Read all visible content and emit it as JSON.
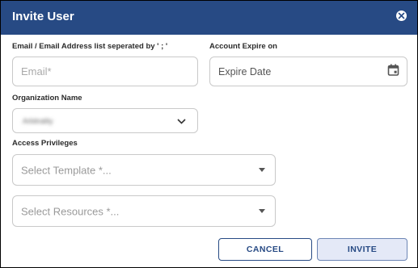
{
  "dialog": {
    "title": "Invite User"
  },
  "email": {
    "label": "Email / Email Address list seperated by ' ; '",
    "placeholder": "Email*"
  },
  "expire": {
    "label": "Account Expire on",
    "placeholder": "Expire Date"
  },
  "organization": {
    "label": "Organization Name",
    "value": "Arbitrality"
  },
  "access": {
    "label": "Access Privileges",
    "template_placeholder": "Select Template *...",
    "resources_placeholder": "Select Resources *..."
  },
  "actions": {
    "cancel": "CANCEL",
    "invite": "INVITE"
  },
  "colors": {
    "header_bg": "#274a84",
    "accent": "#274a84",
    "invite_bg": "#e4e9f7"
  },
  "icons": {
    "close": "close-circle-icon",
    "calendar": "calendar-icon",
    "chevron": "chevron-down-icon",
    "caret": "caret-down-icon"
  }
}
